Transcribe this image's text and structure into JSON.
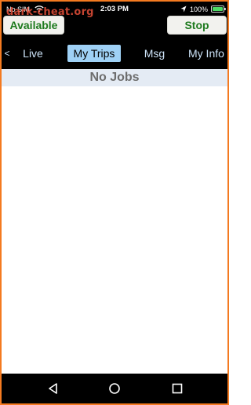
{
  "status_bar": {
    "carrier": "No SIM",
    "time": "2:03 PM",
    "battery_percent": "100%",
    "battery_level": 1.0,
    "icons": [
      "wifi-icon",
      "location-arrow-icon",
      "battery-icon"
    ]
  },
  "watermark": "dark-cheat.org",
  "actions": {
    "available_label": "Available",
    "stop_label": "Stop"
  },
  "tabs": {
    "prev_arrow": "<",
    "items": [
      {
        "label": "Live",
        "active": false
      },
      {
        "label": "My Trips",
        "active": true
      },
      {
        "label": "Msg",
        "active": false
      },
      {
        "label": "My Info",
        "active": false
      }
    ]
  },
  "list": {
    "empty_message": "No Jobs"
  },
  "nav_bar": {
    "icons": [
      "back-triangle-icon",
      "home-circle-icon",
      "recents-square-icon"
    ]
  },
  "colors": {
    "frame_border": "#f47a20",
    "action_text": "#1e7a1e",
    "active_tab_bg": "#9fd1f6",
    "inactive_tab_text": "#cde3f8",
    "header_bg": "#e4ebf4",
    "header_text": "#6d6d6d"
  }
}
